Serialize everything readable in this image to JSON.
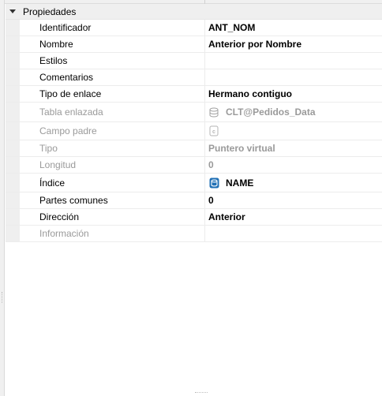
{
  "category": {
    "label": "Propiedades"
  },
  "rows": [
    {
      "name": "Identificador",
      "value": "ANT_NOM",
      "disabled": false,
      "icon": null
    },
    {
      "name": "Nombre",
      "value": "Anterior por Nombre",
      "disabled": false,
      "icon": null
    },
    {
      "name": "Estilos",
      "value": "",
      "disabled": false,
      "icon": null
    },
    {
      "name": "Comentarios",
      "value": "",
      "disabled": false,
      "icon": null
    },
    {
      "name": "Tipo de enlace",
      "value": "Hermano contiguo",
      "disabled": false,
      "icon": null
    },
    {
      "name": "Tabla enlazada",
      "value": "CLT@Pedidos_Data",
      "disabled": true,
      "icon": "database-icon"
    },
    {
      "name": "Campo padre",
      "value": "",
      "disabled": true,
      "icon": "field-icon"
    },
    {
      "name": "Tipo",
      "value": "Puntero virtual",
      "disabled": true,
      "icon": null
    },
    {
      "name": "Longitud",
      "value": "0",
      "disabled": true,
      "icon": null
    },
    {
      "name": "Índice",
      "value": "NAME",
      "disabled": false,
      "icon": "index-icon"
    },
    {
      "name": "Partes comunes",
      "value": "0",
      "disabled": false,
      "icon": null
    },
    {
      "name": "Dirección",
      "value": "Anterior",
      "disabled": false,
      "icon": null
    },
    {
      "name": "Información",
      "value": "",
      "disabled": true,
      "icon": null
    }
  ],
  "colors": {
    "index_icon": "#1f6fb5",
    "disabled_text": "#9a9a9a",
    "gutter": "#efefef"
  }
}
